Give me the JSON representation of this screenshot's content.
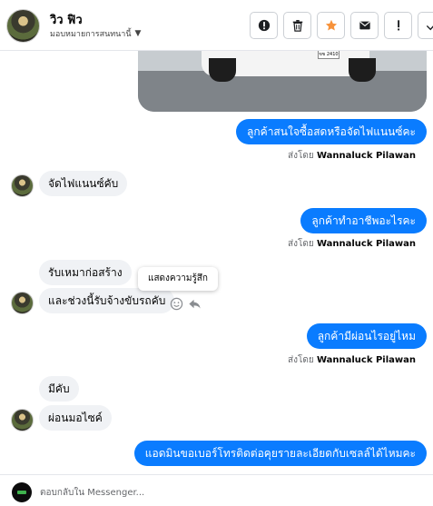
{
  "header": {
    "contact_name": "วิว ฟิว",
    "assign_label": "มอบหมายการสนทนานี้",
    "actions": [
      "spam-icon",
      "trash-icon",
      "star-icon",
      "mail-icon",
      "exclamation-icon",
      "check-icon"
    ]
  },
  "messages": [
    {
      "side": "out",
      "text": "ลูกค้าสนใจซื้อสดหรือจัดไฟแนนซ์คะ"
    },
    {
      "side": "in",
      "text": "จัดไฟแนนซ์คับ"
    },
    {
      "side": "out",
      "text": "ลูกค้าทำอาชีพอะไรคะ"
    },
    {
      "side": "in",
      "text": "รับเหมาก่อสร้าง"
    },
    {
      "side": "in",
      "text": "และช่วงนี้รับจ้างขับรถคับ"
    },
    {
      "side": "out",
      "text": "ลูกค้ามีผ่อนไรอยู่ไหม"
    },
    {
      "side": "in",
      "text": "มีคับ"
    },
    {
      "side": "in",
      "text": "ผ่อนมอไซค์"
    },
    {
      "side": "out",
      "text": "แอดมินขอเบอร์โทรติดต่อคุยรายละเอียดกับเซลล์ได้ไหมคะ"
    }
  ],
  "sent_by": {
    "prefix": "ส่งโดย",
    "name": "Wannaluck Pilawan"
  },
  "photo": {
    "plate_text": "ขข 2410"
  },
  "tooltip": "แสดงความรู้สึก",
  "reply": {
    "placeholder": "ตอบกลับใน Messenger..."
  },
  "colors": {
    "accent": "#0a7cff",
    "incoming_bubble": "#f0f2f5",
    "star": "#f7923a"
  }
}
